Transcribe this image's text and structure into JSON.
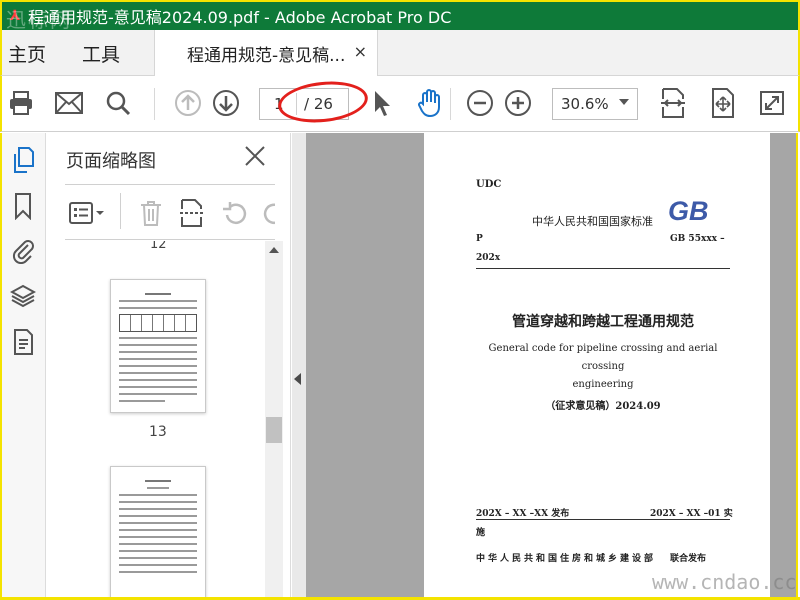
{
  "window": {
    "title": "程通用规范-意见稿2024.09.pdf - Adobe Acrobat Pro DC",
    "watermark": "迅标网"
  },
  "nav": {
    "home": "主页",
    "tools": "工具"
  },
  "tab": {
    "label": "程通用规范-意见稿...",
    "close": "×"
  },
  "toolbar": {
    "current_page": "1",
    "total_pages": "/ 26",
    "zoom": "30.6%"
  },
  "panel": {
    "title": "页面缩略图",
    "prev_page_number": "12",
    "thumb_page_number": "13"
  },
  "document": {
    "udc": "UDC",
    "national_standard": "中华人民共和国国家标准",
    "logo": "GB",
    "p": "P",
    "gb_number": "GB  55xxx  –",
    "year": "202x",
    "title_cn": "管道穿越和跨越工程通用规范",
    "title_en_line1": "General code for pipeline crossing and aerial crossing",
    "title_en_line2": "engineering",
    "draft": "（征求意见稿）2024.09",
    "issue_date": "202X – XX –XX  发布",
    "impl_date": "202X – XX –01  实",
    "impl_suffix": "施",
    "ministry": "中华人民共和国住房和城乡建设部",
    "joint": "联合发布"
  },
  "site_watermark": "www.cndao.cc",
  "colors": {
    "titlebar": "#0e7a39",
    "border": "#f4e300",
    "accent_blue": "#1a73c9",
    "annotation_red": "#e3201c"
  }
}
